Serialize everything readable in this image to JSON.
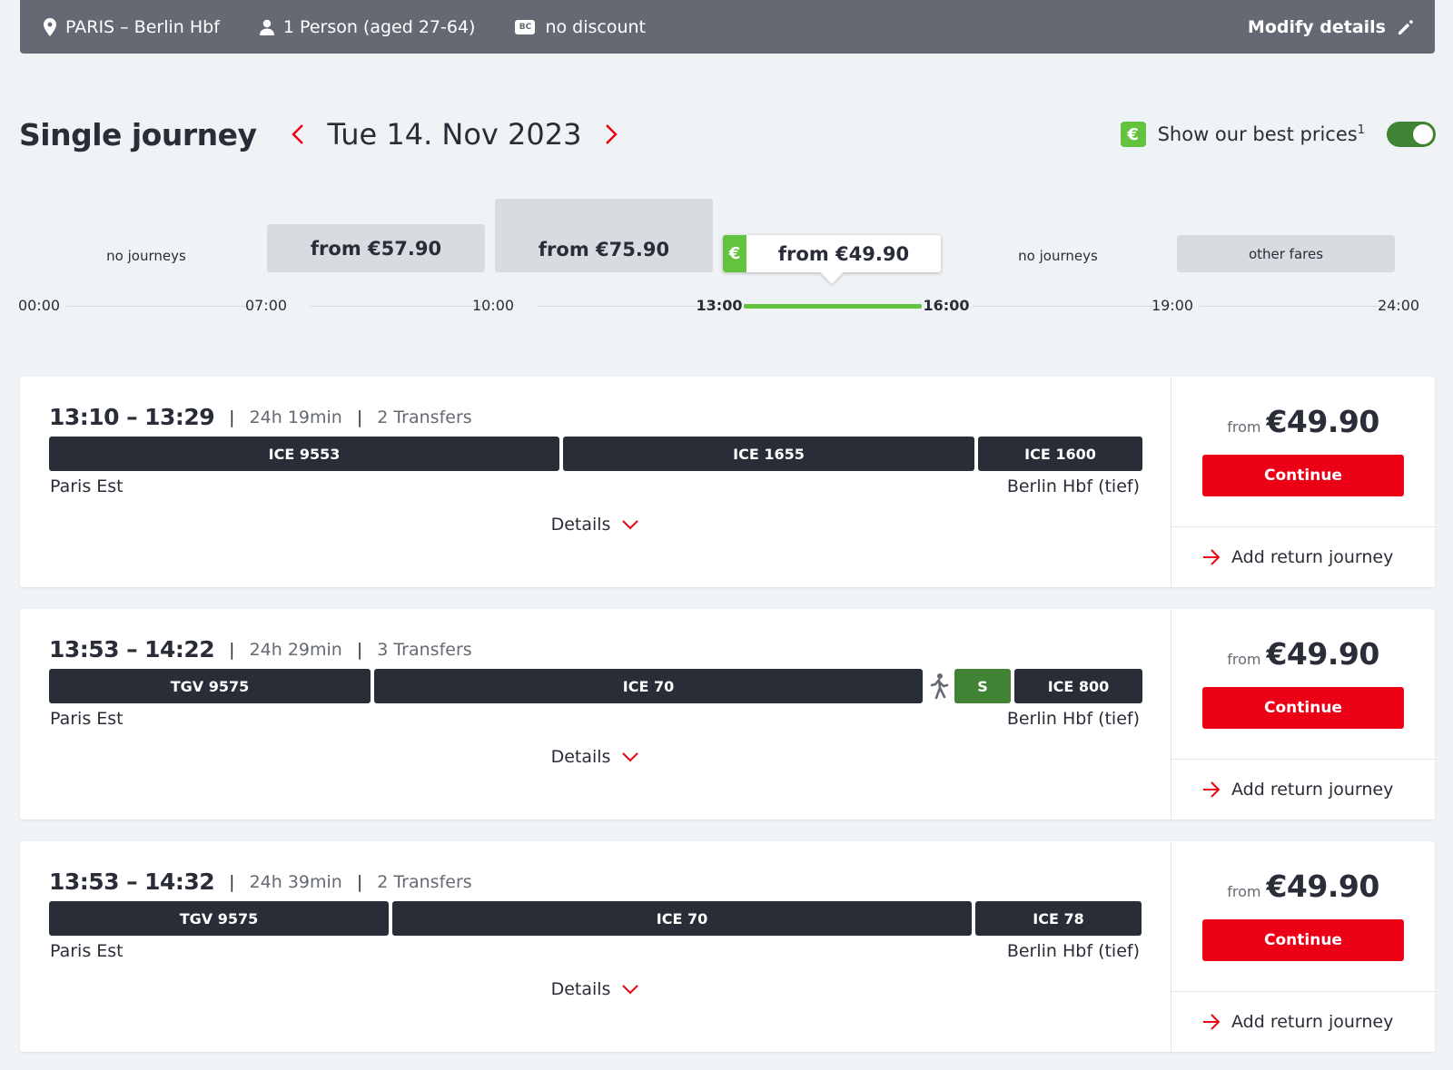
{
  "topbar": {
    "route": "PARIS – Berlin Hbf",
    "passengers": "1 Person (aged 27-64)",
    "bc_badge": "BC",
    "discount": "no discount",
    "modify_label": "Modify details"
  },
  "heading": {
    "title": "Single journey",
    "date": "Tue 14. Nov 2023",
    "best_prices_badge": "€",
    "best_prices_label": "Show our best prices",
    "best_prices_footnote": "1",
    "best_prices_on": true
  },
  "timeline": {
    "slots": [
      {
        "label": "no journeys"
      },
      {
        "label": "from €57.90"
      },
      {
        "label": "from €75.90"
      },
      {
        "label": "from €49.90",
        "badge": "€"
      },
      {
        "label": "no journeys"
      },
      {
        "label": "other fares"
      }
    ],
    "ticks": [
      "00:00",
      "07:00",
      "10:00",
      "13:00",
      "16:00",
      "19:00",
      "24:00"
    ]
  },
  "journeys": [
    {
      "departure": "13:10",
      "dash": "–",
      "arrival": "13:29",
      "separator": "|",
      "duration": "24h 19min",
      "transfers": "2 Transfers",
      "segments": [
        "ICE 9553",
        "ICE 1655",
        "ICE 1600"
      ],
      "from_station": "Paris Est",
      "to_station": "Berlin Hbf (tief)",
      "details_label": "Details",
      "price_prefix": "from",
      "price": "€49.90",
      "continue_label": "Continue",
      "return_label": "Add return journey"
    },
    {
      "departure": "13:53",
      "dash": "–",
      "arrival": "14:22",
      "separator": "|",
      "duration": "24h 29min",
      "transfers": "3 Transfers",
      "segments": [
        "TGV 9575",
        "ICE 70",
        "S",
        "ICE 800"
      ],
      "from_station": "Paris Est",
      "to_station": "Berlin Hbf (tief)",
      "details_label": "Details",
      "price_prefix": "from",
      "price": "€49.90",
      "continue_label": "Continue",
      "return_label": "Add return journey"
    },
    {
      "departure": "13:53",
      "dash": "–",
      "arrival": "14:32",
      "separator": "|",
      "duration": "24h 39min",
      "transfers": "2 Transfers",
      "segments": [
        "TGV 9575",
        "ICE 70",
        "ICE 78"
      ],
      "from_station": "Paris Est",
      "to_station": "Berlin Hbf (tief)",
      "details_label": "Details",
      "price_prefix": "from",
      "price": "€49.90",
      "continue_label": "Continue",
      "return_label": "Add return journey"
    }
  ],
  "colors": {
    "topbar": "#646973",
    "accent_red": "#ec0016",
    "green": "#63c33e",
    "dark_green": "#408335",
    "segment": "#282d37"
  },
  "icons": {
    "route": "location-pin-icon",
    "passengers": "person-icon",
    "modify": "pencil-icon",
    "prev_date": "chevron-left-icon",
    "next_date": "chevron-right-icon",
    "details": "chevron-down-icon",
    "return": "arrow-right-icon",
    "walk": "walking-person-icon"
  }
}
